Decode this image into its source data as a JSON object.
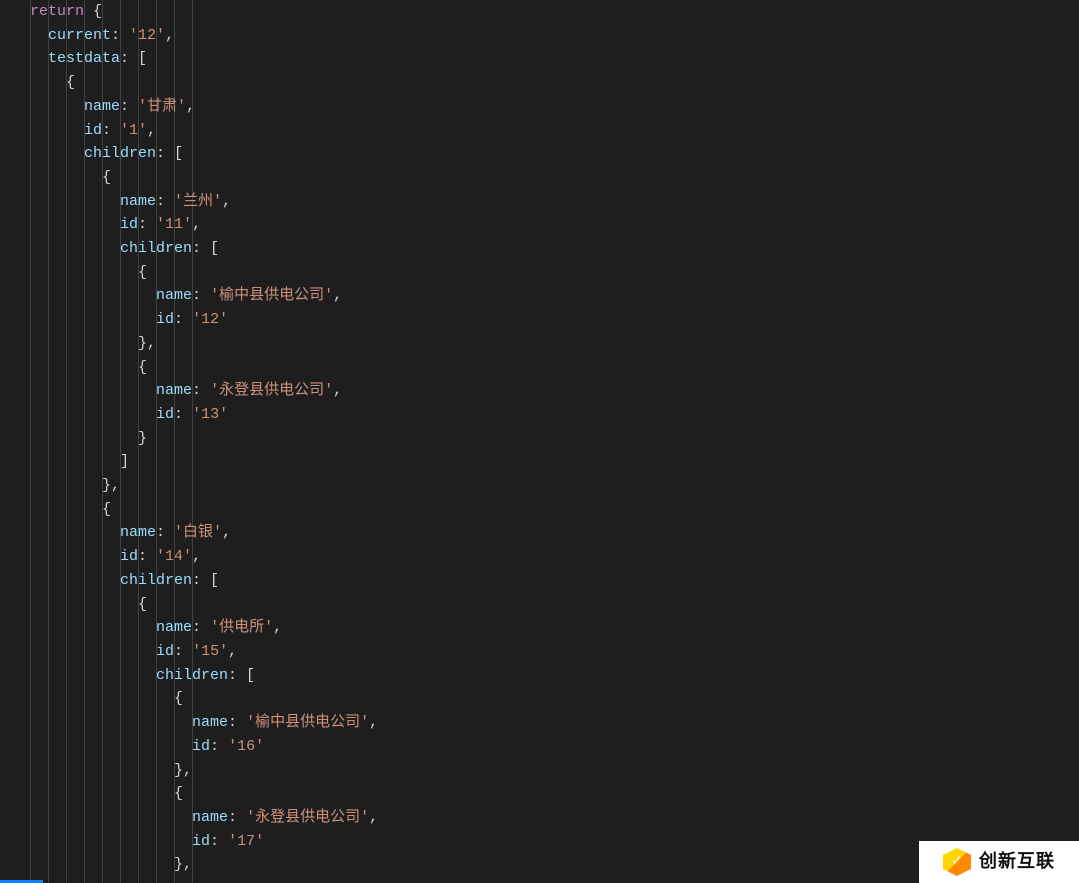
{
  "code": {
    "keyword_return": "return",
    "prop_current": "current",
    "val_current": "'12'",
    "prop_testdata": "testdata",
    "prop_name": "name",
    "prop_id": "id",
    "prop_children": "children",
    "items": {
      "gansu": {
        "name": "'甘肃'",
        "id": "'1'"
      },
      "lanzhou": {
        "name": "'兰州'",
        "id": "'11'"
      },
      "yuzhong1": {
        "name": "'榆中县供电公司'",
        "id": "'12'"
      },
      "yongdeng1": {
        "name": "'永登县供电公司'",
        "id": "'13'"
      },
      "baiyin": {
        "name": "'白银'",
        "id": "'14'"
      },
      "gongdiansuo": {
        "name": "'供电所'",
        "id": "'15'"
      },
      "yuzhong2": {
        "name": "'榆中县供电公司'",
        "id": "'16'"
      },
      "yongdeng2": {
        "name": "'永登县供电公司'",
        "id": "'17'"
      }
    }
  },
  "logo_text": "创新互联"
}
